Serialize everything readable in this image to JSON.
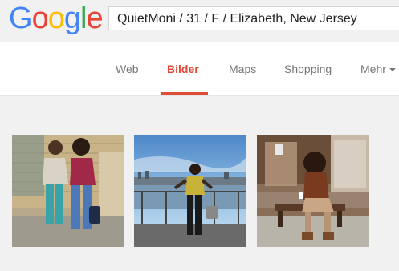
{
  "logo": {
    "letters": [
      "G",
      "o",
      "o",
      "g",
      "l",
      "e"
    ],
    "colors": [
      "#4285f4",
      "#ea4335",
      "#fbbc05",
      "#4285f4",
      "#34a853",
      "#ea4335"
    ]
  },
  "search": {
    "value": "QuietMoni / 31 / F / Elizabeth, New Jersey"
  },
  "tabs": [
    {
      "label": "Web"
    },
    {
      "label": "Bilder",
      "active": true
    },
    {
      "label": "Maps"
    },
    {
      "label": "Shopping"
    },
    {
      "label": "Mehr"
    }
  ],
  "images": [
    {
      "name": "two-women-posing-brick-wall"
    },
    {
      "name": "woman-posing-waterfront-railing"
    },
    {
      "name": "woman-sitting-bench-storefront"
    }
  ],
  "colors": {
    "accent": "#dd4b39",
    "tab_text": "#777777"
  }
}
